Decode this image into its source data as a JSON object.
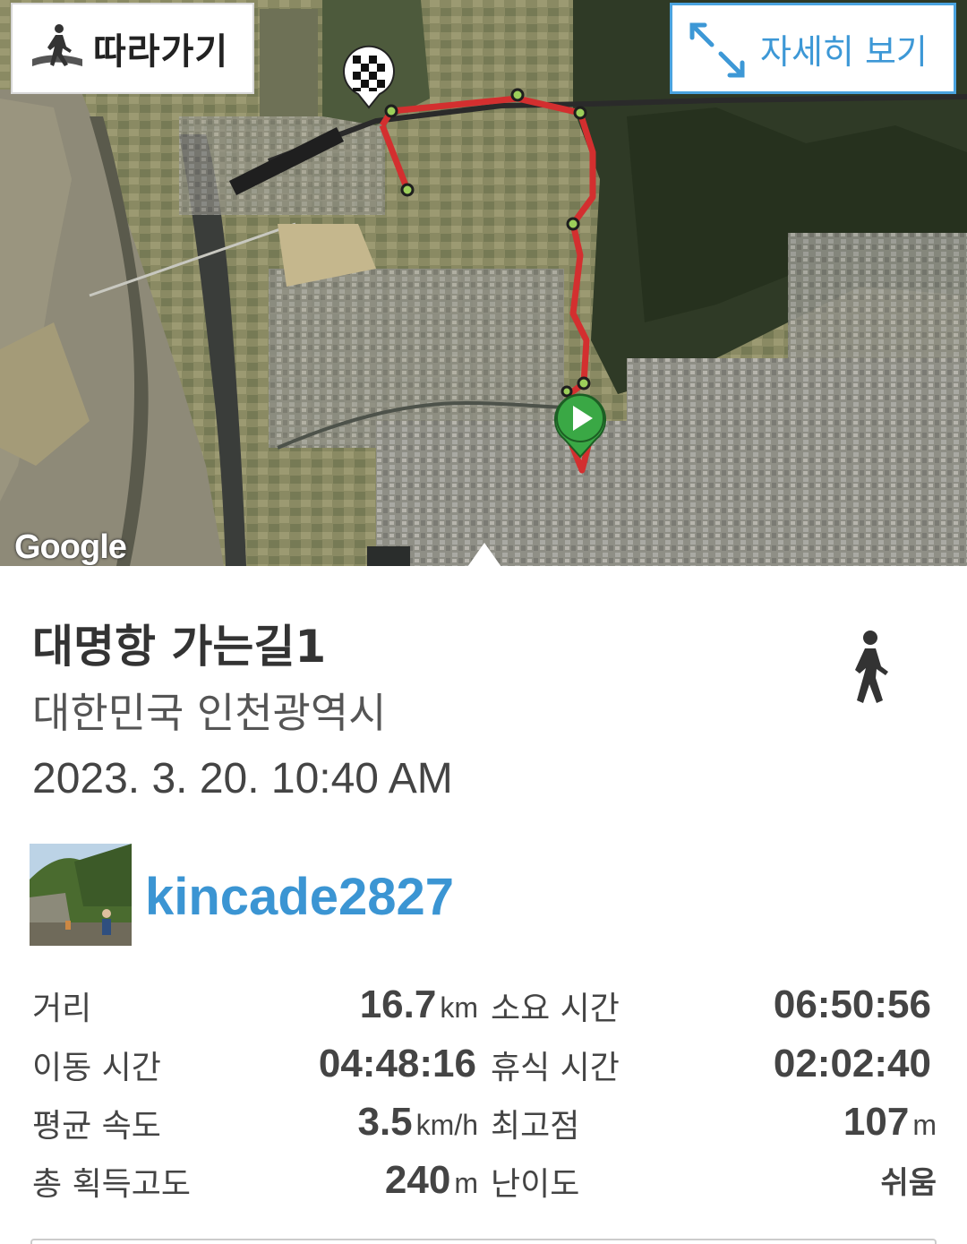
{
  "map": {
    "follow_label": "따라가기",
    "detail_label": "자세히 보기",
    "provider_logo": "Google",
    "icons": [
      "walking-person-icon",
      "expand-arrows-icon",
      "finish-flag-icon",
      "start-play-icon"
    ],
    "route_color": "#d32f2f"
  },
  "record": {
    "title": "대명항 가는길1",
    "location": "대한민국 인천광역시",
    "datetime": "2023. 3. 20. 10:40 AM",
    "activity_icon": "walking-person-icon",
    "username": "kincade2827"
  },
  "stats": {
    "distance_label": "거리",
    "distance_value": "16.7",
    "distance_unit": "km",
    "total_time_label": "소요 시간",
    "total_time_value": "06:50:56",
    "moving_time_label": "이동 시간",
    "moving_time_value": "04:48:16",
    "rest_time_label": "휴식 시간",
    "rest_time_value": "02:02:40",
    "avg_speed_label": "평균 속도",
    "avg_speed_value": "3.5",
    "avg_speed_unit": "km/h",
    "max_elev_label": "최고점",
    "max_elev_value": "107",
    "max_elev_unit": "m",
    "total_ascent_label": "총 획득고도",
    "total_ascent_value": "240",
    "total_ascent_unit": "m",
    "difficulty_label": "난이도",
    "difficulty_value": "쉬움"
  },
  "colors": {
    "accent_blue": "#3b95d3",
    "route_red": "#d32f2f",
    "start_green": "#3aa845"
  }
}
